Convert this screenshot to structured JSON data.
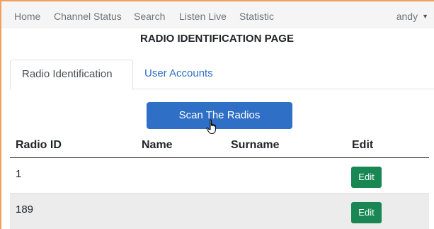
{
  "navbar": {
    "items": [
      {
        "label": "Home"
      },
      {
        "label": "Channel Status"
      },
      {
        "label": "Search"
      },
      {
        "label": "Listen Live"
      },
      {
        "label": "Statistic"
      }
    ],
    "user": "andy",
    "caret_icon": "caret-down-icon"
  },
  "page": {
    "title": "RADIO IDENTIFICATION PAGE"
  },
  "tabs": [
    {
      "label": "Radio Identification",
      "active": true
    },
    {
      "label": "User Accounts",
      "active": false
    }
  ],
  "scan_button": {
    "label": "Scan The Radios"
  },
  "table": {
    "columns": [
      "Radio ID",
      "Name",
      "Surname",
      "Edit"
    ],
    "rows": [
      {
        "radio_id": "1",
        "name": "",
        "surname": "",
        "edit_label": "Edit"
      },
      {
        "radio_id": "189",
        "name": "",
        "surname": "",
        "edit_label": "Edit"
      }
    ]
  },
  "colors": {
    "primary": "#2f6fc5",
    "success": "#198754",
    "navbar_bg": "#f5f5f5",
    "frame_border": "#f0a05a"
  }
}
